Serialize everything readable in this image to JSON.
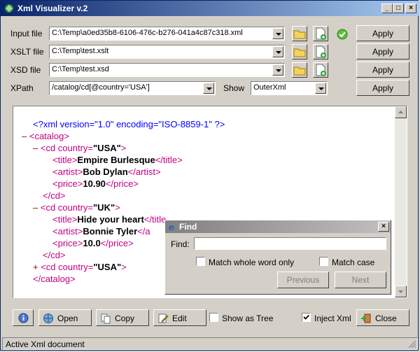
{
  "window": {
    "title": "Xml Visualizer v.2",
    "minimize": "_",
    "maximize": "□",
    "close": "×"
  },
  "inputs": {
    "input_file": {
      "label": "Input file",
      "value": "C:\\Temp\\a0ed35b8-6106-476c-b276-041a4c87c318.xml",
      "apply": "Apply"
    },
    "xslt_file": {
      "label": "XSLT file",
      "value": "C:\\Temp\\test.xslt",
      "apply": "Apply"
    },
    "xsd_file": {
      "label": "XSD file",
      "value": "C:\\Temp\\test.xsd",
      "apply": "Apply"
    },
    "xpath": {
      "label": "XPath",
      "value": "/catalog/cd[@country='USA']",
      "show_label": "Show",
      "show_value": "OuterXml",
      "apply": "Apply"
    }
  },
  "xml": {
    "decl": "<?xml version=\"1.0\" encoding=\"ISO-8859-1\" ?>",
    "catalog_open": "<catalog>",
    "catalog_close": "</catalog>",
    "cd_tag": "<cd country=",
    "cd1_country": "\"USA\"",
    "cd2_country": "\"UK\"",
    "cd3_country": "\"USA\"",
    "tag_close": ">",
    "cd_close": "</cd>",
    "title_open": "<title>",
    "title_close": "</title>",
    "artist_open": "<artist>",
    "artist_close": "</artist>",
    "price_open": "<price>",
    "price_close": "</price>",
    "cd1_title": "Empire Burlesque",
    "cd1_artist": "Bob Dylan",
    "cd1_price": "10.90",
    "cd2_title": "Hide your heart",
    "cd2_artist": "Bonnie Tyler",
    "cd2_price": "10.0",
    "minus": "–",
    "plus": "+",
    "clipped_title_close": "</title",
    "clipped_artist_close": "</a"
  },
  "find_dialog": {
    "title": "Find",
    "find_label": "Find:",
    "find_value": "",
    "match_whole": "Match whole word only",
    "match_case": "Match case",
    "previous": "Previous",
    "next": "Next",
    "close": "×"
  },
  "toolbar": {
    "open": "Open",
    "copy": "Copy",
    "edit": "Edit",
    "show_as_tree": "Show as Tree",
    "inject_xml": "Inject Xml",
    "close": "Close",
    "inject_checked": true
  },
  "status": {
    "text": "Active Xml document"
  }
}
